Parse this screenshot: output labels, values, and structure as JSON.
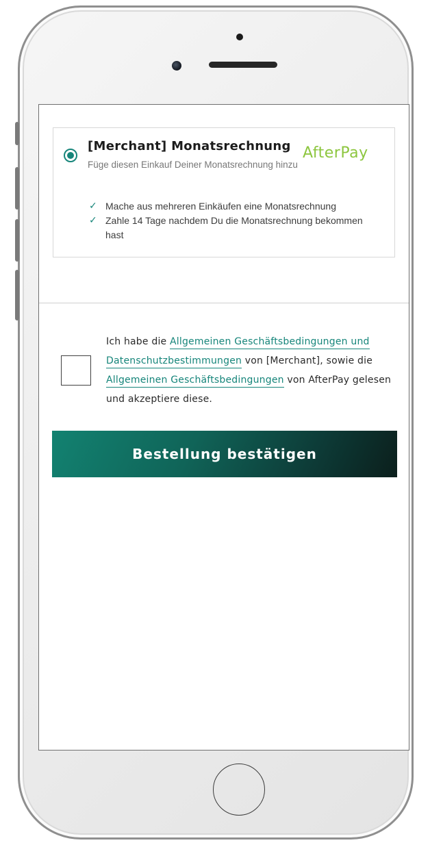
{
  "payment_option": {
    "title": "[Merchant] Monatsrechnung",
    "subtitle": "Füge diesen Einkauf Deiner Monatsrechnung hinzu",
    "selected": true,
    "brand": "AfterPay",
    "benefits": [
      "Mache aus mehreren Einkäufen eine Monatsrechnung",
      "Zahle 14 Tage nachdem Du die Monatsrechnung bekommen hast"
    ]
  },
  "terms": {
    "checked": false,
    "text_1": "Ich habe die ",
    "link_1": "Allgemeinen Geschäftsbedingungen und Datenschutzbestimmungen",
    "text_2": " von [Merchant], sowie die ",
    "link_2": "Allgemeinen Geschäftsbedingungen",
    "text_3": " von AfterPay gelesen und akzeptiere diese."
  },
  "confirm_button": {
    "label": "Bestellung bestätigen"
  },
  "colors": {
    "accent": "#16857a",
    "brand_green": "#8dc63f",
    "button_gradient_start": "#128271",
    "button_gradient_end": "#0b1f1c"
  },
  "icons": {
    "radio": "radio-selected-icon",
    "check": "checkmark-icon"
  }
}
